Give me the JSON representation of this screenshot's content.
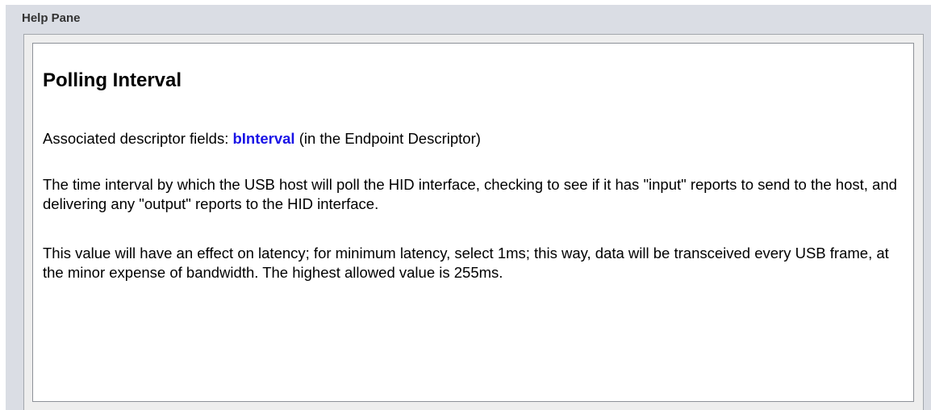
{
  "pane": {
    "title": "Help Pane"
  },
  "help": {
    "heading": "Polling Interval",
    "fields_prefix": "Associated descriptor fields: ",
    "field_link": "bInterval",
    "fields_suffix": " (in the Endpoint Descriptor)",
    "paragraph_1": "The time interval by which the USB host will poll the HID interface, checking to see if it has \"input\" reports to send to the host, and delivering any \"output\" reports to the HID interface.",
    "paragraph_2": "This value will have an effect on latency; for minimum latency, select 1ms; this way, data will be transceived every USB frame, at the minor expense of bandwidth. The highest allowed value is 255ms."
  },
  "colors": {
    "pane_background": "#dadde4",
    "link": "#1a14e6",
    "content_background": "#ffffff"
  }
}
